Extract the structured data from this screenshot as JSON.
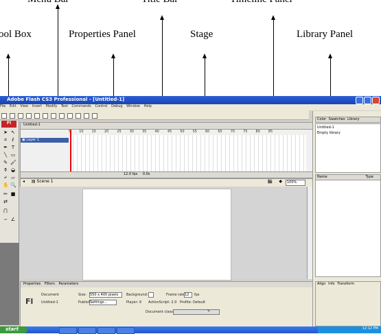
{
  "callouts": {
    "menu_bar": "Menu Bar",
    "title_bar": "Title Bar",
    "timeline_panel": "Timeline Panel",
    "tool_box": "ool Box",
    "properties_panel": "Properties Panel",
    "stage": "Stage",
    "library_panel": "Library Panel"
  },
  "window": {
    "title": "Adobe Flash CS3 Professional - [Untitled-1]",
    "menu": [
      "File",
      "Edit",
      "View",
      "Insert",
      "Modify",
      "Text",
      "Commands",
      "Control",
      "Debug",
      "Window",
      "Help"
    ],
    "toolbox_logo": "Fl"
  },
  "timeline": {
    "tab": "Untitled-1",
    "layer_name": "Layer 1",
    "frames": [
      "5",
      "10",
      "15",
      "20",
      "25",
      "30",
      "35",
      "40",
      "45",
      "50",
      "55",
      "60",
      "65",
      "70",
      "75",
      "80",
      "85"
    ],
    "footer_fps": "12.0 fps",
    "footer_time": "0.0s"
  },
  "editbar": {
    "scene": "Scene 1",
    "zoom": "100%"
  },
  "properties": {
    "tabs": [
      "Properties",
      "Filters",
      "Parameters"
    ],
    "doc_icon": "Fl",
    "document_label": "Document",
    "document_name": "Untitled-1",
    "size_label": "Size:",
    "size_value": "550 x 400 pixels",
    "background_label": "Background:",
    "framerate_label": "Frame rate:",
    "framerate_value": "12",
    "fps_unit": "fps",
    "publish_label": "Publish:",
    "settings_label": "Settings...",
    "player_label": "Player: 9",
    "actionscript_label": "ActionScript: 2.0",
    "profile_label": "Profile: Default",
    "docclass_label": "Document class:"
  },
  "right_panel": {
    "tabs": [
      "Color",
      "Swatches",
      "Library"
    ],
    "library_doc": "Untitled-1",
    "library_empty": "Empty library",
    "col_name": "Name",
    "col_type": "Type",
    "lower_tabs": [
      "Align",
      "Info",
      "Transform"
    ]
  },
  "taskbar": {
    "start": "start",
    "clock": "12:12 PM"
  }
}
